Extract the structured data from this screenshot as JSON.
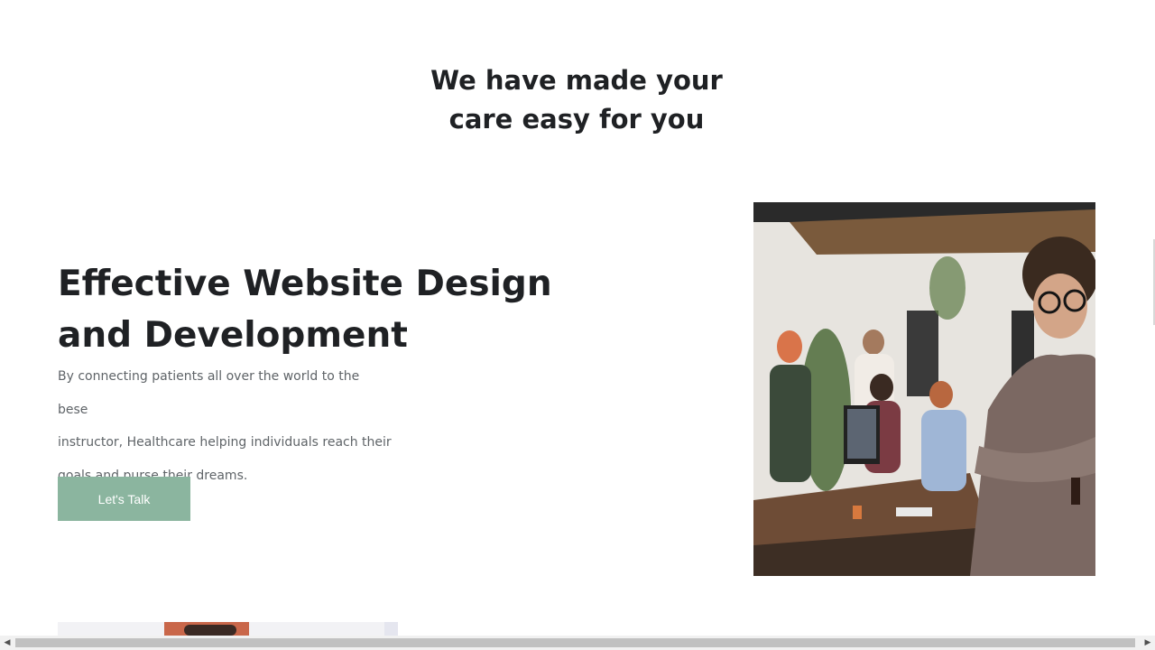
{
  "section": {
    "heading_line1": "We have made your",
    "heading_line2": "care easy for you"
  },
  "hero": {
    "title_line1": "Effective Website Design",
    "title_line2": "and Development",
    "text_line1": "By connecting patients all over the world to the bese",
    "text_line2": "instructor, Healthcare helping individuals reach their",
    "text_line3": "goals and purse their dreams.",
    "button_label": "Let's Talk"
  },
  "scrollbar": {
    "left_arrow": "◀",
    "right_arrow": "▶"
  },
  "colors": {
    "accent": "#8bb59f",
    "heading": "#1f2124",
    "body_text": "#5f6468"
  }
}
